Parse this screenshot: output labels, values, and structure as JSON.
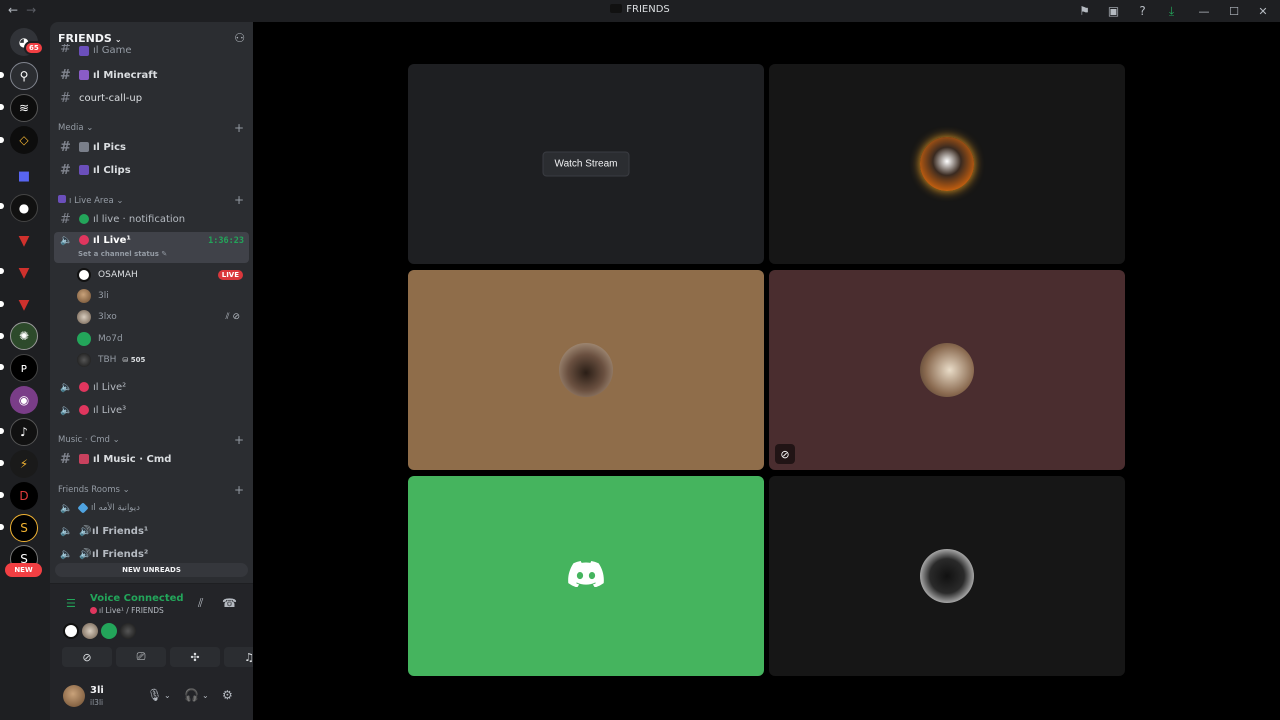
{
  "window": {
    "title": "FRIENDS",
    "nav_back": "←",
    "nav_forward": "→",
    "icons": [
      "inbox-icon",
      "screen-icon",
      "help-icon",
      "download-icon"
    ],
    "controls": [
      "minimize",
      "maximize",
      "close"
    ]
  },
  "rail": {
    "home_badge": "65",
    "new_badge": "NEW"
  },
  "server": {
    "name": "FRIENDS",
    "channels_top": [
      {
        "name": "ıl Game",
        "type": "text"
      },
      {
        "name": "ıl Minecraft",
        "type": "text"
      },
      {
        "name": "court-call-up",
        "type": "text"
      }
    ],
    "categories": {
      "media": "Media",
      "live_area": "ı Live Area",
      "music": "Music · Cmd",
      "friends_rooms": "Friends Rooms"
    },
    "media_channels": [
      {
        "name": "ıl Pics"
      },
      {
        "name": "ıl Clips"
      }
    ],
    "live_notification": "ıl live · notification",
    "active_voice": {
      "name": "ıl Live¹",
      "timer": "1:36:23",
      "status": "Set a channel status"
    },
    "voice_users": [
      {
        "name": "OSAMAH",
        "badge": "LIVE"
      },
      {
        "name": "3li"
      },
      {
        "name": "3lxo"
      },
      {
        "name": "Mo7d"
      },
      {
        "name": "TBH",
        "boost": "505"
      }
    ],
    "live_channels": [
      "ıl Live²",
      "ıl Live³"
    ],
    "music_channel": "ıl Music · Cmd",
    "friends_channels": [
      "ıl دیوانیة الأمه",
      "ıl Friends¹",
      "ıl Friends²"
    ],
    "new_unreads": "NEW UNREADS"
  },
  "voice_panel": {
    "title": "Voice Connected",
    "subtitle": "ıl Live¹ / FRIENDS"
  },
  "user_panel": {
    "name": "3li",
    "sub": "il3li"
  },
  "stage": {
    "watch_stream": "Watch Stream",
    "tile_colors": [
      "#1e1f22",
      "#161616",
      "#8f6d4a",
      "#4a2d2f",
      "#45b45e",
      "#161616"
    ]
  }
}
